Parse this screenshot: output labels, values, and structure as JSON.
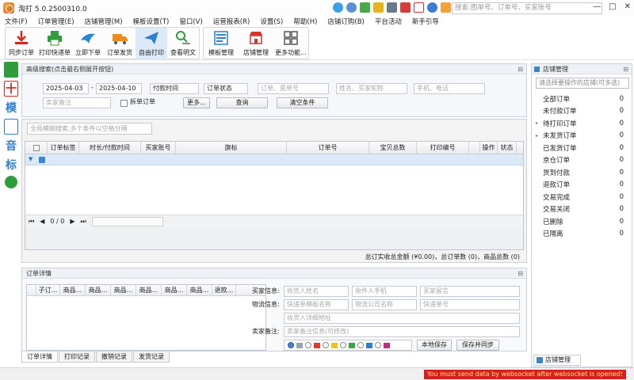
{
  "window": {
    "title": "淘打 5.0.2500310.0",
    "search_placeholder": "搜索:图单号、订单号、买家账号",
    "controls": [
      "—",
      "□",
      "✕"
    ]
  },
  "menu": [
    "文件(F)",
    "订单管理(E)",
    "店铺管理(M)",
    "模板设置(T)",
    "窗口(V)",
    "运营报表(R)",
    "设置(S)",
    "帮助(H)",
    "店铺订购(B)",
    "平台活动",
    "新手引导"
  ],
  "toolbar": {
    "group1": [
      "同步订单",
      "打印快递单",
      "立即下单",
      "订单发货",
      "自由打印",
      "查看明文"
    ],
    "group2": [
      "模板管理",
      "店铺管理",
      "更多功能..."
    ]
  },
  "left_bar_icons": [
    "add-order-icon",
    "red-ten-icon",
    "template-icon",
    "add-icon",
    "list-icon",
    "tag-icon",
    "settings-icon"
  ],
  "left_bar_text": [
    "",
    "十",
    "模",
    "",
    "音",
    "标",
    ""
  ],
  "search": {
    "header": "高级搜索(点击最右侧展开按钮)",
    "date_from": "2025-04-03",
    "separator": "-",
    "date_to": "2025-04-10",
    "time_type": "付款时间",
    "order_status": "订单状态",
    "order_no_placeholder": "订单、面单号",
    "buyer_placeholder": "姓名、买家昵称",
    "phone_placeholder": "手机、电话",
    "buyer_note_placeholder": "卖家备注",
    "split_label": "拆单订单",
    "more_button": "更多...",
    "query_button": "查询",
    "clear_button": "清空条件"
  },
  "grid": {
    "filter_placeholder": "全局模糊搜索,多个条件以空格分隔",
    "columns": [
      "",
      "订单标签",
      "时长/付款时间",
      "买家账号",
      "旗标",
      "订单号",
      "宝贝总数",
      "打印编号",
      "",
      "操作",
      "状态"
    ],
    "pager": {
      "first": "⏮",
      "prev": "◀",
      "page": "0 / 0",
      "next": "▶",
      "last": "⏭"
    },
    "summary": "总订实收总金额 (¥0.00)，总订单数 (0)，商品总数 (0)"
  },
  "detail": {
    "header": "订单详情",
    "columns": [
      "子订...",
      "商品...",
      "商品...",
      "商品...",
      "商品...",
      "商品...",
      "商品...",
      "退款..."
    ],
    "buyer_label": "买家信息:",
    "receiver_name_ph": "收货人姓名",
    "receiver_phone_ph": "收件人手机",
    "buyer_msg_ph": "买家留言",
    "logistics_label": "物流信息:",
    "template_ph": "快递单模板名称",
    "company_ph": "物流公司名称",
    "waybill_ph": "快递单号",
    "address_ph": "收货人详细地址",
    "seller_label": "卖家备注:",
    "seller_note_ph": "卖家备注信息(可修改)",
    "save_local": "本地保存",
    "save_sync": "保存并同步"
  },
  "bottom_tabs": [
    "订单详情",
    "打印记录",
    "撤销记录",
    "发货记录"
  ],
  "store": {
    "header": "店铺管理",
    "select_placeholder": "请选择要操作的店铺(可多选)",
    "items": [
      {
        "label": "全部订单",
        "count": "0"
      },
      {
        "label": "未付款订单",
        "count": "0"
      },
      {
        "label": "待打印订单",
        "count": "0",
        "arrow": "▸"
      },
      {
        "label": "未发货订单",
        "count": "0",
        "arrow": "▸"
      },
      {
        "label": "已发货订单",
        "count": "0"
      },
      {
        "label": "京仓订单",
        "count": "0"
      },
      {
        "label": "货到付款",
        "count": "0"
      },
      {
        "label": "退款订单",
        "count": "0"
      },
      {
        "label": "交易完成",
        "count": "0"
      },
      {
        "label": "交易关闭",
        "count": "0"
      },
      {
        "label": "已删除",
        "count": "0"
      },
      {
        "label": "已隔离",
        "count": "0"
      }
    ],
    "tab_label": "店铺管理"
  },
  "status": {
    "error": "You must send data by websocket after websocket is opened!"
  },
  "colors": {
    "accent": "#2f7fd1",
    "error_bg": "#d81f1f",
    "error_text": "#ffe97a"
  }
}
